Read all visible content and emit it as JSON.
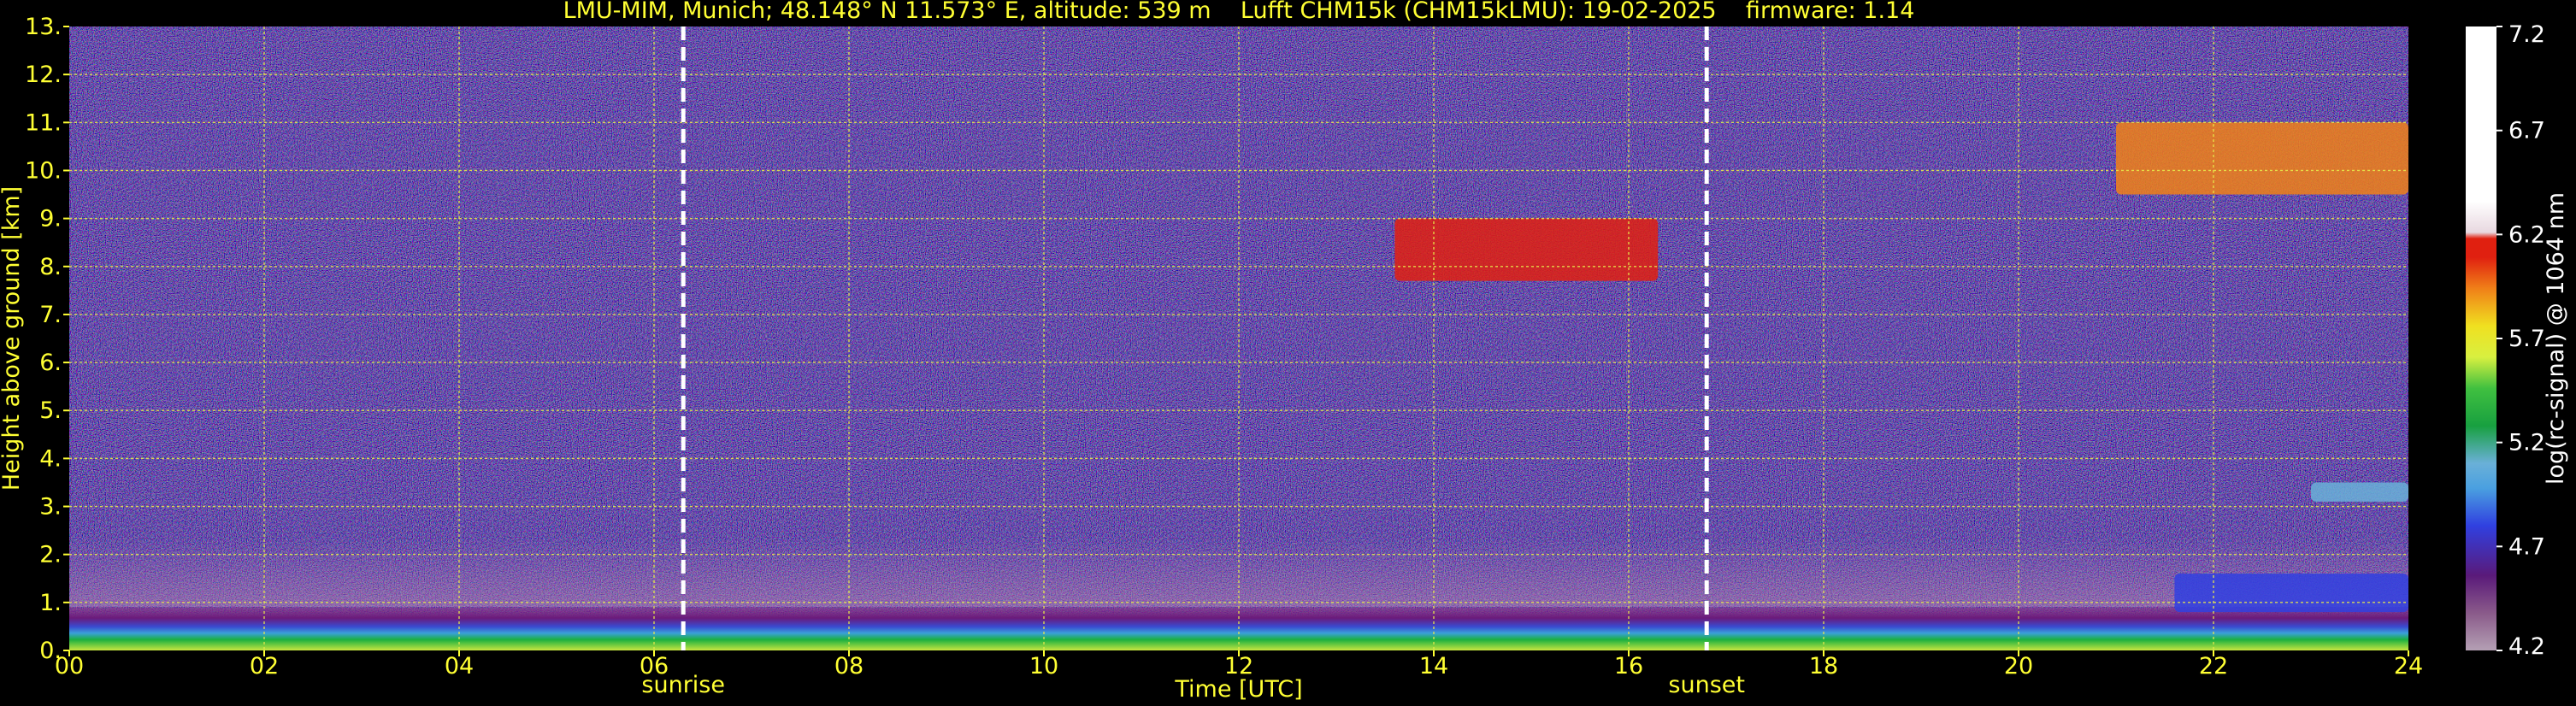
{
  "chart_data": {
    "type": "heatmap",
    "title": "LMU-MIM, Munich; 48.148° N 11.573° E, altitude: 539 m    Lufft CHM15k (CHM15kLMU): 19-02-2025    firmware: 1.14",
    "xlabel": "Time [UTC]",
    "ylabel": "Height above ground [km]",
    "colorbar_label": "log(rc-signal) @ 1064 nm",
    "xlim": [
      0,
      24
    ],
    "ylim": [
      0,
      13
    ],
    "x_ticks": [
      0,
      2,
      4,
      6,
      8,
      10,
      12,
      14,
      16,
      18,
      20,
      22,
      24
    ],
    "x_tick_labels": [
      "00",
      "02",
      "04",
      "06",
      "08",
      "10",
      "12",
      "14",
      "16",
      "18",
      "20",
      "22",
      "24"
    ],
    "y_ticks": [
      0,
      1,
      2,
      3,
      4,
      5,
      6,
      7,
      8,
      9,
      10,
      11,
      12,
      13
    ],
    "y_tick_labels": [
      "0.",
      "1.",
      "2.",
      "3.",
      "4.",
      "5.",
      "6.",
      "7.",
      "8.",
      "9.",
      "10.",
      "11.",
      "12.",
      "13."
    ],
    "colorbar_ticks": [
      4.2,
      4.7,
      5.2,
      5.7,
      6.2,
      6.7,
      7.2
    ],
    "colorbar_tick_labels": [
      "4.2",
      "4.7",
      "5.2",
      "5.7",
      "6.2",
      "6.7",
      "7.2"
    ],
    "colorbar_range": [
      4.2,
      7.2
    ],
    "grid": true,
    "markers": [
      {
        "label": "sunrise",
        "x": 6.3
      },
      {
        "label": "sunset",
        "x": 16.8
      }
    ],
    "features": [
      {
        "x_range": [
          0,
          24
        ],
        "height_range_km": [
          0,
          0.9
        ],
        "log_signal": 5.3
      },
      {
        "x_range": [
          13.6,
          16.3
        ],
        "height_range_km": [
          7.7,
          9.0
        ],
        "log_signal": 6.2
      },
      {
        "x_range": [
          21.0,
          24.0
        ],
        "height_range_km": [
          9.5,
          11.0
        ],
        "log_signal": 6.0
      },
      {
        "x_range": [
          23.0,
          24.0
        ],
        "height_range_km": [
          3.1,
          3.5
        ],
        "log_signal": 5.2
      },
      {
        "x_range": [
          21.6,
          24.0
        ],
        "height_range_km": [
          0.8,
          1.6
        ],
        "log_signal": 4.9
      }
    ]
  }
}
